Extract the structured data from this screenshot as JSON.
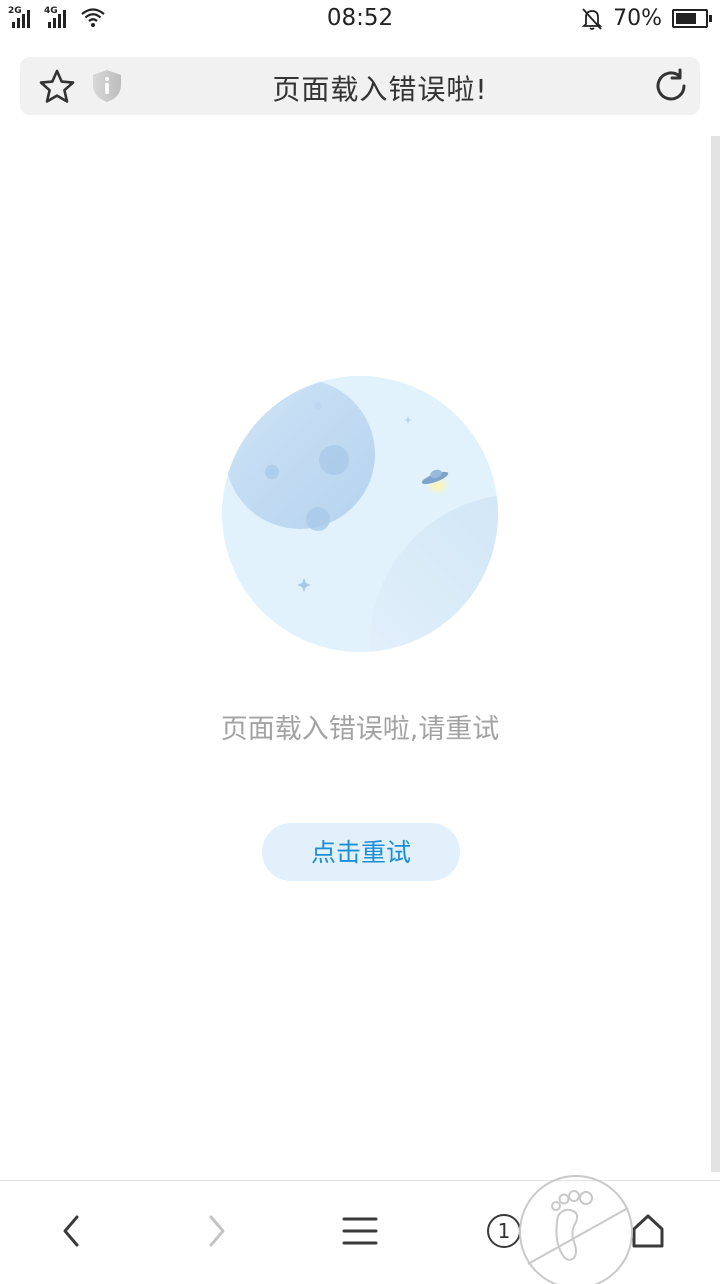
{
  "status_bar": {
    "network_1": "2G",
    "network_2": "4G",
    "time": "08:52",
    "battery": "70%",
    "battery_level": 0.7
  },
  "address_bar": {
    "title": "页面载入错误啦!",
    "icons": [
      "star-icon",
      "shield-info-icon",
      "refresh-icon"
    ]
  },
  "error_page": {
    "message": "页面载入错误啦,请重试",
    "retry_label": "点击重试"
  },
  "bottom_bar": {
    "tab_count": "1",
    "icons": [
      "back-icon",
      "forward-icon",
      "menu-icon",
      "tabs-icon",
      "home-icon"
    ]
  },
  "colors": {
    "accent": "#1a8fd6",
    "retry_bg": "#e2f0fb",
    "planet": "#e1f2fc"
  }
}
